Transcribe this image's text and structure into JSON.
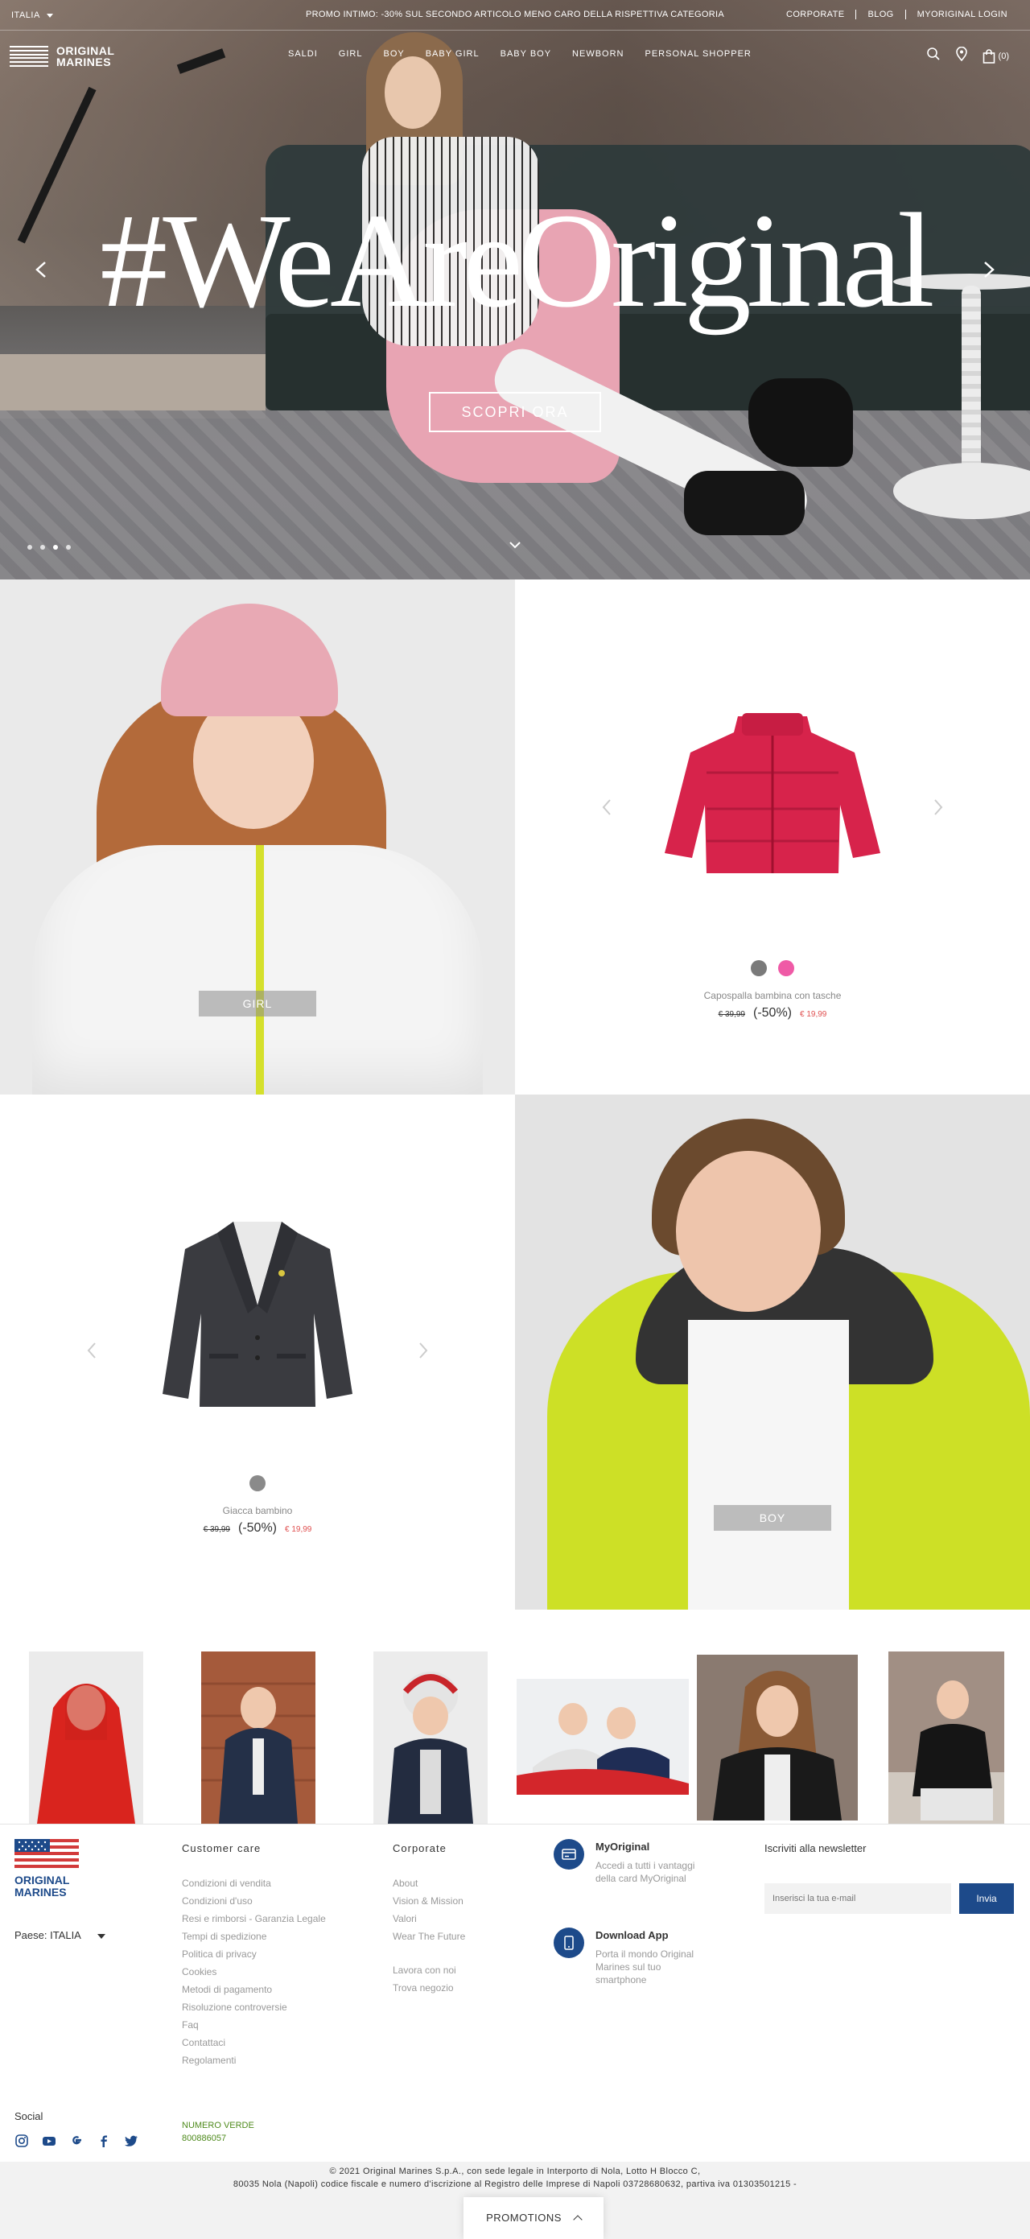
{
  "topbar": {
    "country": "ITALIA",
    "promo": "PROMO INTIMO: -30% SUL SECONDO ARTICOLO MENO CARO DELLA RISPETTIVA CATEGORIA",
    "links": [
      "CORPORATE",
      "BLOG",
      "MYORIGINAL LOGIN"
    ]
  },
  "brand": {
    "line1": "ORIGINAL",
    "line2": "MARINES"
  },
  "nav": {
    "items": [
      "SALDI",
      "GIRL",
      "BOY",
      "BABY GIRL",
      "BABY BOY",
      "NEWBORN",
      "PERSONAL SHOPPER"
    ],
    "cart_count": "(0)"
  },
  "hero": {
    "title": "#WeAreOriginal",
    "cta": "SCOPRI ORA",
    "slides": 4,
    "active_slide": 2
  },
  "tiles": {
    "girl_label": "GIRL",
    "boy_label": "BOY",
    "product1": {
      "name": "Capospalla bambina con tasche",
      "old_price": "€ 39,99",
      "discount": "(-50%)",
      "new_price": "€ 19,99",
      "swatches": [
        "#7a7a7a",
        "#ef5aa6"
      ]
    },
    "product2": {
      "name": "Giacca bambino",
      "old_price": "€ 39,99",
      "discount": "(-50%)",
      "new_price": "€ 19,99",
      "swatches": [
        "#8a8a8a"
      ]
    }
  },
  "footer": {
    "brand": {
      "line1": "ORIGINAL",
      "line2": "MARINES"
    },
    "country": "Paese: ITALIA",
    "customer_care": {
      "title": "Customer care",
      "links": [
        "Condizioni di vendita",
        "Condizioni d'uso",
        "Resi e rimborsi - Garanzia Legale",
        "Tempi di spedizione",
        "Politica di privacy",
        "Cookies",
        "Metodi di pagamento",
        "Risoluzione controversie",
        "Faq",
        "Contattaci",
        "Regolamenti"
      ]
    },
    "corporate": {
      "title": "Corporate",
      "links": [
        "About",
        "Vision & Mission",
        "Valori",
        "Wear The Future"
      ],
      "links2": [
        "Lavora con noi",
        "Trova negozio"
      ]
    },
    "myoriginal": {
      "title": "MyOriginal",
      "desc": "Accedi a tutti i vantaggi della card MyOriginal"
    },
    "app": {
      "title": "Download App",
      "desc": "Porta il mondo Original Marines sul tuo smartphone"
    },
    "newsletter": {
      "title": "Iscriviti alla newsletter",
      "placeholder": "Inserisci la tua e-mail",
      "button": "Invia"
    },
    "social_title": "Social",
    "numero_verde_label": "NUMERO VERDE",
    "numero_verde": "800886057"
  },
  "legal": {
    "line1": "© 2021 Original Marines S.p.A., con sede legale in Interporto di Nola, Lotto H Blocco C,",
    "line2": "80035 Nola (Napoli) codice fiscale e numero d'iscrizione al Registro delle Imprese di Napoli 03728680632, partiva iva 01303501215 -"
  },
  "promotions": "PROMOTIONS",
  "colors": {
    "brand_blue": "#1d4a8a",
    "sale_red": "#e05050",
    "verde": "#4e8a1c"
  }
}
